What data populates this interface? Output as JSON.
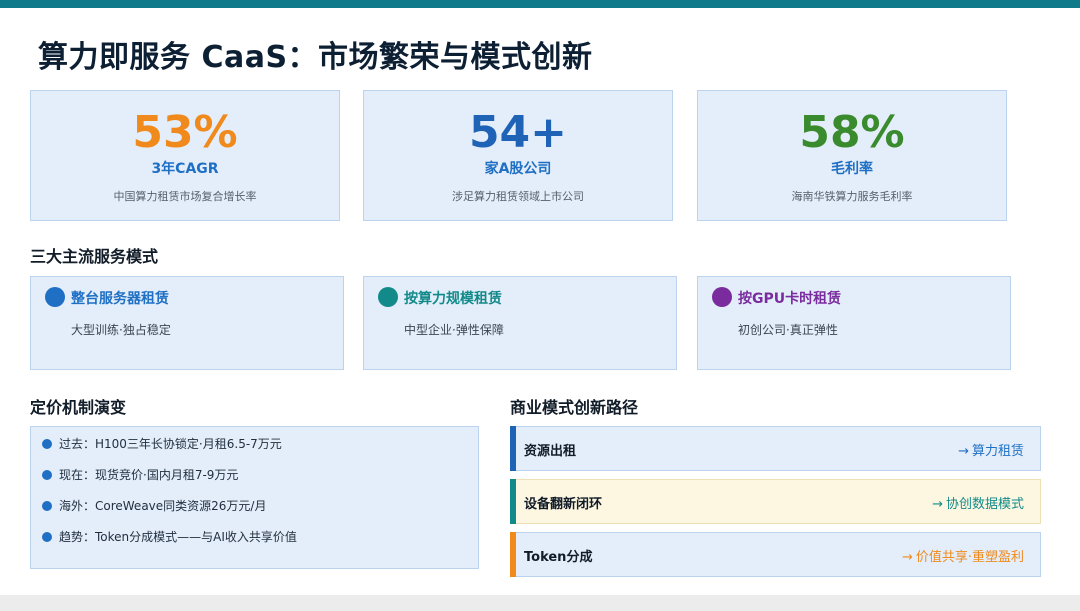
{
  "title": "算力即服务 CaaS：市场繁荣与模式创新",
  "stats": [
    {
      "value": "53%",
      "label": "3年CAGR",
      "desc": "中国算力租赁市场复合增长率",
      "color": "#f08a1c"
    },
    {
      "value": "54+",
      "label": "家A股公司",
      "desc": "涉足算力租赁领域上市公司",
      "color": "#1f63b6"
    },
    {
      "value": "58%",
      "label": "毛利率",
      "desc": "海南华铁算力服务毛利率",
      "color": "#3a8a2e"
    }
  ],
  "modes_section": {
    "title": "三大主流服务模式"
  },
  "modes": [
    {
      "name": "整台服务器租赁",
      "desc": "大型训练·独占稳定",
      "color": "#1f6fc4"
    },
    {
      "name": "按算力规模租赁",
      "desc": "中型企业·弹性保障",
      "color": "#138a8a"
    },
    {
      "name": "按GPU卡时租赁",
      "desc": "初创公司·真正弹性",
      "color": "#7a2c9e"
    }
  ],
  "pricing_section": {
    "title": "定价机制演变",
    "items": [
      "过去：H100三年长协锁定·月租6.5-7万元",
      "现在：现货竞价·国内月租7-9万元",
      "海外：CoreWeave同类资源26万元/月",
      "趋势：Token分成模式——与AI收入共享价值"
    ]
  },
  "path_section": {
    "title": "商业模式创新路径",
    "rows": [
      {
        "label": "资源出租",
        "arrow": "→",
        "result": "算力租赁",
        "accent": "#1f63b6",
        "result_color": "#1f6fc4"
      },
      {
        "label": "设备翻新闭环",
        "arrow": "→",
        "result": "协创数据模式",
        "accent": "#138a8a",
        "result_color": "#138a8a"
      },
      {
        "label": "Token分成",
        "arrow": "→",
        "result": "价值共享·重塑盈利",
        "accent": "#f08a1c",
        "result_color": "#f08a1c"
      }
    ]
  }
}
